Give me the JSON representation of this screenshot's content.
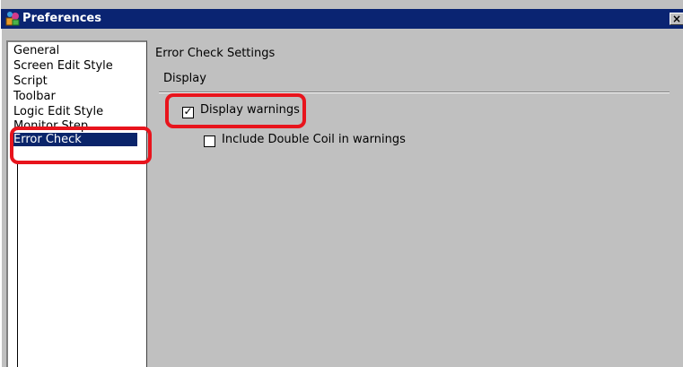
{
  "window": {
    "title": "Preferences",
    "close_glyph": "×"
  },
  "sidebar": {
    "items": [
      {
        "label": "General"
      },
      {
        "label": "Screen Edit Style"
      },
      {
        "label": "Script"
      },
      {
        "label": "Toolbar"
      },
      {
        "label": "Logic Edit Style"
      },
      {
        "label": "Monitor Step"
      },
      {
        "label": "Error Check",
        "selected": true
      }
    ]
  },
  "content": {
    "heading": "Error Check Settings",
    "group_label": "Display",
    "options": [
      {
        "label": "Display warnings",
        "checked": true
      },
      {
        "label": "Include Double Coil in warnings",
        "checked": false
      }
    ]
  },
  "colors": {
    "titlebar": "#0a2472",
    "selection": "#0a246a",
    "highlight_ring": "#e8141c",
    "dialog_face": "#c0c0c0"
  },
  "icons": {
    "app_icon": "preferences-app-icon",
    "checkmark": "✓"
  }
}
